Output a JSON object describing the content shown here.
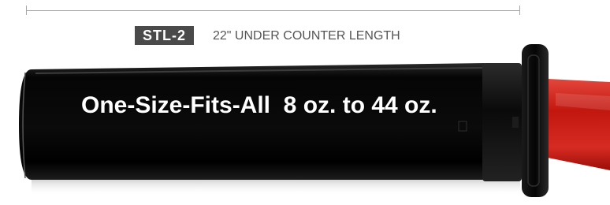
{
  "dimension": {
    "model": "STL-2",
    "length_label": "22\" UNDER COUNTER LENGTH"
  },
  "product": {
    "headline": "One-Size-Fits-All  8 oz. to 44 oz."
  },
  "colors": {
    "tube_body": "#0b0b0b",
    "badge_bg": "#4a4a4a",
    "cone_accent": "#d62b22",
    "dimension_line": "#a7a7a7"
  }
}
